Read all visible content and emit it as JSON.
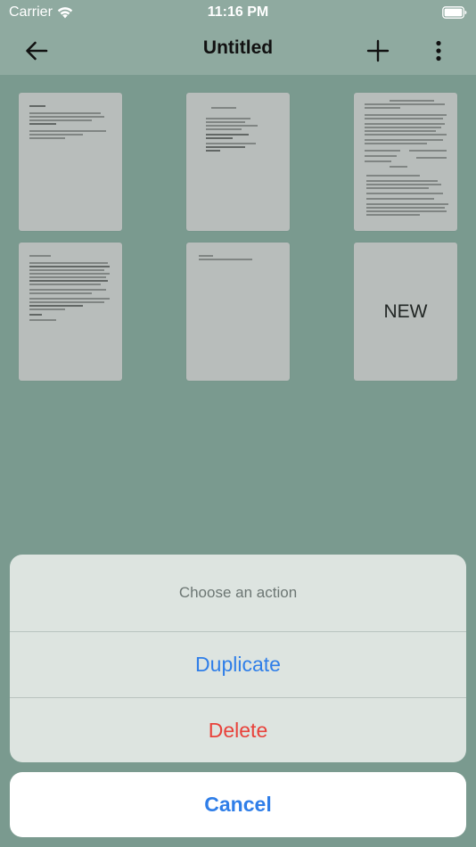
{
  "status_bar": {
    "carrier": "Carrier",
    "time": "11:16 PM",
    "icons": [
      "wifi-icon",
      "battery-icon"
    ]
  },
  "nav": {
    "title": "Untitled",
    "icons": [
      "arrow-left-icon",
      "plus-icon",
      "more-vertical-icon"
    ]
  },
  "documents": {
    "new_label": "NEW"
  },
  "action_sheet": {
    "title": "Choose an action",
    "duplicate_label": "Duplicate",
    "delete_label": "Delete",
    "cancel_label": "Cancel"
  },
  "colors": {
    "background": "#7d9e93",
    "nav_background": "#8faaa0",
    "card": "#c8c8c8",
    "sheet": "#dde4e0",
    "accent_blue": "#2f7ee8",
    "destructive_red": "#e8413a"
  }
}
